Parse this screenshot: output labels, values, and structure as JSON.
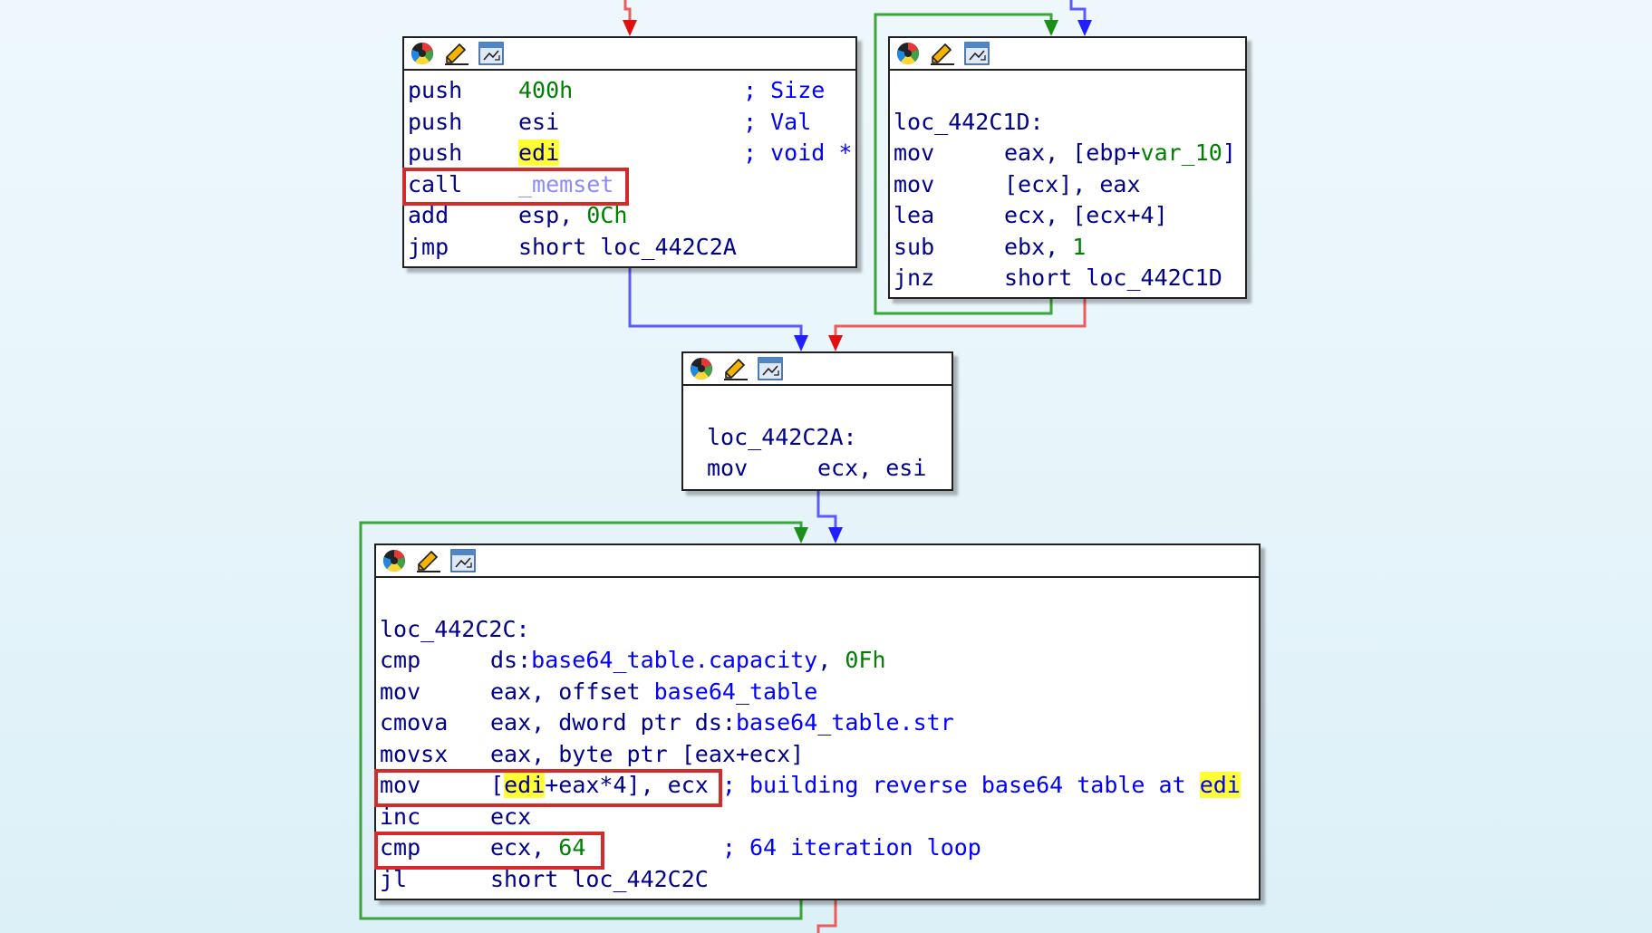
{
  "graph": {
    "colors": {
      "true_edge": "#1a8f1a",
      "false_edge": "#e01010",
      "jump_edge": "#2020ff",
      "loop_back_edge": "#1a8f1a",
      "highlight_box": "#d42a2a",
      "highlight_text": "#ffff33"
    },
    "header_icons": [
      "color-wheel-icon",
      "rename-pencil-icon",
      "graph-overview-icon"
    ],
    "node_memset": {
      "lines": [
        {
          "mnemonic": "push",
          "operand": "400h",
          "comment": "; Size"
        },
        {
          "mnemonic": "push",
          "operand": "esi",
          "comment": "; Val"
        },
        {
          "mnemonic": "push",
          "operand": "edi",
          "comment": "; void *"
        },
        {
          "mnemonic": "call",
          "operand": "_memset",
          "comment": ""
        },
        {
          "mnemonic": "add",
          "operand": "esp, ",
          "operand_num": "0Ch",
          "comment": ""
        },
        {
          "mnemonic": "jmp",
          "operand": "short loc_442C2A",
          "comment": ""
        }
      ]
    },
    "node_442C1D": {
      "label": "loc_442C1D:",
      "lines": [
        {
          "mnemonic": "mov",
          "operand_a": "eax, [ebp+",
          "operand_var": "var_10",
          "operand_b": "]"
        },
        {
          "mnemonic": "mov",
          "operand": "[ecx], eax"
        },
        {
          "mnemonic": "lea",
          "operand": "ecx, [ecx+4]"
        },
        {
          "mnemonic": "sub",
          "operand": "ebx, ",
          "operand_num": "1"
        },
        {
          "mnemonic": "jnz",
          "operand": "short loc_442C1D"
        }
      ]
    },
    "node_442C2A": {
      "label": "loc_442C2A:",
      "lines": [
        {
          "mnemonic": "mov",
          "operand": "ecx, esi"
        }
      ]
    },
    "node_442C2C": {
      "label": "loc_442C2C:",
      "lines": [
        {
          "mnemonic": "cmp",
          "operand_a": "ds:",
          "operand_sym": "base64_table.capacity",
          "operand_b": ", ",
          "operand_num": "0Fh"
        },
        {
          "mnemonic": "mov",
          "operand_a": "eax, offset ",
          "operand_sym": "base64_table"
        },
        {
          "mnemonic": "cmova",
          "operand_a": "eax, dword ptr ds:",
          "operand_sym": "base64_table.str"
        },
        {
          "mnemonic": "movsx",
          "operand": "eax, byte ptr [eax+ecx]"
        },
        {
          "mnemonic": "mov",
          "operand_a": "[",
          "operand_hl": "edi",
          "operand_b": "+eax*4], ecx",
          "comment_a": " ; building reverse base64 table at ",
          "comment_hl": "edi"
        },
        {
          "mnemonic": "inc",
          "operand": "ecx"
        },
        {
          "mnemonic": "cmp",
          "operand": "ecx, ",
          "operand_num": "64",
          "comment": "          ; 64 iteration loop"
        },
        {
          "mnemonic": "jl",
          "operand": "short loc_442C2C"
        }
      ]
    }
  }
}
